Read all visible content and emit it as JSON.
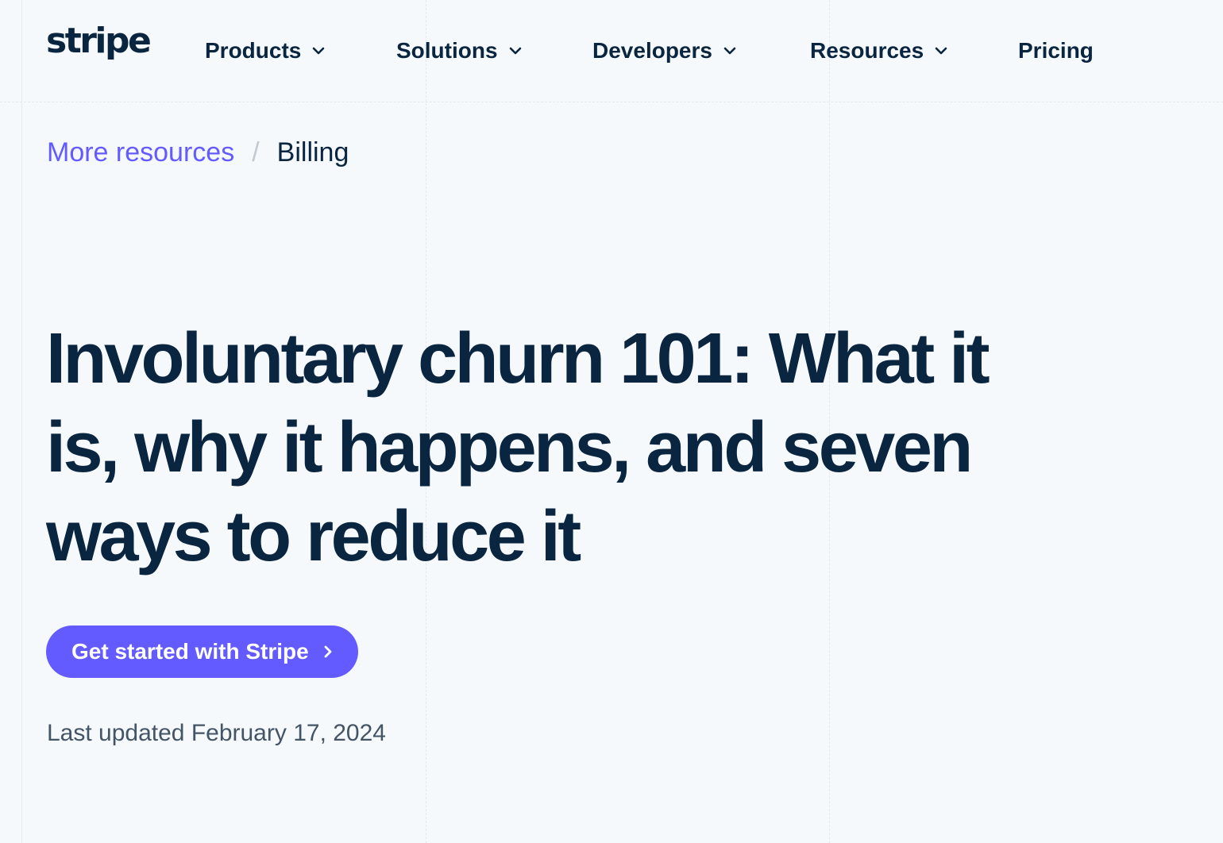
{
  "header": {
    "logo_text": "stripe",
    "nav": [
      {
        "label": "Products",
        "has_dropdown": true,
        "icon": "chevron-down-icon"
      },
      {
        "label": "Solutions",
        "has_dropdown": true,
        "icon": "chevron-down-icon"
      },
      {
        "label": "Developers",
        "has_dropdown": true,
        "icon": "chevron-down-icon"
      },
      {
        "label": "Resources",
        "has_dropdown": true,
        "icon": "chevron-down-icon"
      },
      {
        "label": "Pricing",
        "has_dropdown": false
      }
    ]
  },
  "breadcrumb": {
    "parent": "More resources",
    "separator": "/",
    "current": "Billing"
  },
  "article": {
    "title": "Involuntary churn 101: What it is, why it happens, and seven ways to reduce it",
    "cta_label": "Get started with Stripe",
    "cta_icon": "chevron-right-icon",
    "last_updated": "Last updated February 17, 2024"
  },
  "colors": {
    "background": "#f6f9fc",
    "text": "#0a2540",
    "accent": "#635bff",
    "muted_text": "#425466"
  }
}
